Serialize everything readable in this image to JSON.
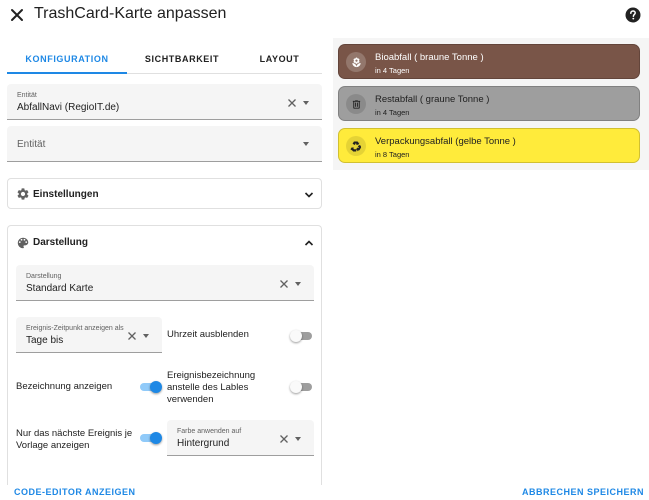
{
  "dialog": {
    "title": "TrashCard-Karte anpassen"
  },
  "tabs": [
    {
      "label": "KONFIGURATION",
      "active": true
    },
    {
      "label": "SICHTBARKEIT",
      "active": false
    },
    {
      "label": "LAYOUT",
      "active": false
    }
  ],
  "entity1": {
    "label": "Entität",
    "value": "AbfallNavi (RegioIT.de)"
  },
  "entity2": {
    "placeholder": "Entität"
  },
  "settings": {
    "title": "Einstellungen",
    "expanded": false
  },
  "appearance": {
    "title": "Darstellung",
    "expanded": true,
    "layout": {
      "label": "Darstellung",
      "value": "Standard Karte"
    },
    "event_time": {
      "label": "Ereignis-Zeitpunkt anzeigen als",
      "value": "Tage bis"
    },
    "hide_time": {
      "label": "Uhrzeit ausblenden",
      "on": false
    },
    "show_label": {
      "label": "Bezeichnung anzeigen",
      "on": true
    },
    "event_name": {
      "label_line1": "Ereignisbezeichnung",
      "label_line2": "anstelle des Lables",
      "label_line3": "verwenden",
      "on": false
    },
    "next_only": {
      "label_line1": "Nur das nächste Ereignis je",
      "label_line2": "Vorlage anzeigen",
      "on": true
    },
    "color_mode": {
      "label": "Farbe anwenden auf",
      "value": "Hintergrund"
    }
  },
  "preview": [
    {
      "name": "Bioabfall ( braune Tonne )",
      "days": "in 4 Tagen",
      "icon": "flower-icon",
      "bg": "#795548",
      "fg": "#ffffff",
      "icon_bg": "rgba(255,255,255,0.2)",
      "icon_fg": "#ffffff"
    },
    {
      "name": "Restabfall ( graune Tonne )",
      "days": "in 4 Tagen",
      "icon": "trash-can-icon",
      "bg": "#9e9e9e",
      "fg": "#212121",
      "icon_bg": "rgba(0,0,0,0.12)",
      "icon_fg": "#212121"
    },
    {
      "name": "Verpackungsabfall (gelbe Tonne )",
      "days": "in 8 Tagen",
      "icon": "recycle-icon",
      "bg": "#ffeb3b",
      "fg": "#212121",
      "icon_bg": "rgba(0,0,0,0.1)",
      "icon_fg": "#212121"
    }
  ],
  "footer": {
    "code_editor": "CODE-EDITOR ANZEIGEN",
    "cancel": "ABBRECHEN",
    "save": "SPEICHERN"
  },
  "colors": {
    "accent": "#1e88e5",
    "toggle_on_track": "#90caf9"
  }
}
